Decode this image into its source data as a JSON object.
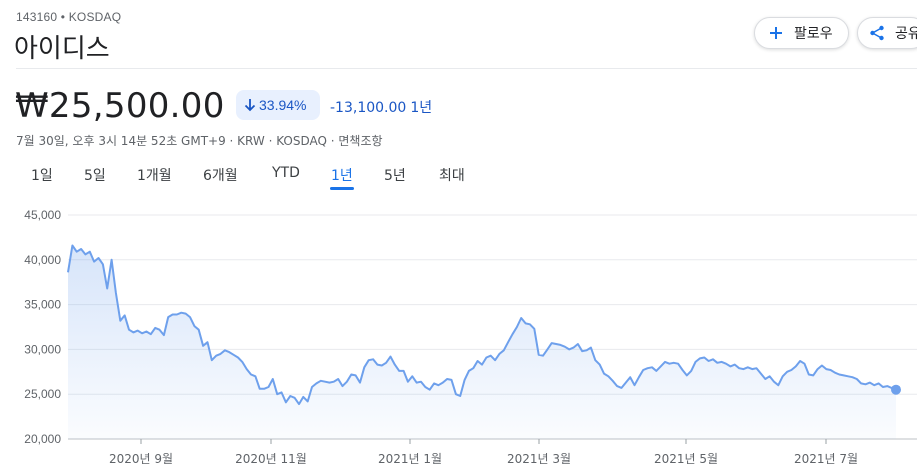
{
  "header": {
    "ticker": "143160 • KOSDAQ",
    "company": "아이디스",
    "follow_label": "팔로우",
    "share_label": "공유"
  },
  "quote": {
    "price": "₩25,500.00",
    "change_pct": "33.94%",
    "change_abs": "-13,100.00",
    "change_period": "1년",
    "meta": "7월 30일, 오후 3시 14분 52초 GMT+9 · KRW · KOSDAQ · 면책조항"
  },
  "range_tabs": [
    {
      "label": "1일"
    },
    {
      "label": "5일"
    },
    {
      "label": "1개월"
    },
    {
      "label": "6개월"
    },
    {
      "label": "YTD"
    },
    {
      "label": "1년",
      "active": true
    },
    {
      "label": "5년"
    },
    {
      "label": "최대"
    }
  ],
  "colors": {
    "line": "#6ea0ec",
    "accent": "#1a73e8",
    "negative": "#1a56c4"
  },
  "icons": {
    "follow": "plus-icon",
    "share": "share-icon",
    "change": "arrow-down-icon"
  },
  "chart_data": {
    "type": "area",
    "title": "",
    "xlabel": "",
    "ylabel": "",
    "ylim": [
      20000,
      45000
    ],
    "yticks": [
      "45,000",
      "40,000",
      "35,000",
      "30,000",
      "25,000",
      "20,000"
    ],
    "xticks": [
      "2020년 9월",
      "2020년 11월",
      "2021년 1월",
      "2021년 3월",
      "2021년 5월",
      "2021년 7월"
    ],
    "grid": true,
    "series": [
      {
        "values": [
          38600,
          41600,
          40900,
          41200,
          40600,
          40900,
          39800,
          40200,
          39500,
          36800,
          40000,
          36300,
          33200,
          33800,
          32200,
          31900,
          32100,
          31800,
          32000,
          31700,
          32400,
          32200,
          31600,
          33600,
          33900,
          33900,
          34100,
          34000,
          33600,
          32600,
          32200,
          30400,
          30800,
          28800,
          29300,
          29500,
          29900,
          29700,
          29400,
          29100,
          28600,
          27800,
          27200,
          27000,
          25600,
          25600,
          25800,
          26700,
          25000,
          25200,
          24100,
          24800,
          24600,
          23900,
          24700,
          24200,
          25800,
          26200,
          26500,
          26400,
          26300,
          26400,
          26700,
          25900,
          26400,
          27200,
          27100,
          26300,
          28000,
          28800,
          28900,
          28300,
          28200,
          28500,
          29200,
          28300,
          27600,
          27600,
          26400,
          27000,
          26300,
          26400,
          25800,
          25500,
          26200,
          26000,
          26300,
          26700,
          26600,
          25000,
          24800,
          26600,
          27600,
          27900,
          28700,
          28300,
          29100,
          29300,
          28800,
          29500,
          29900,
          30800,
          31700,
          32500,
          33500,
          32900,
          32800,
          32300,
          29400,
          29300,
          30000,
          30700,
          30600,
          30500,
          30300,
          30000,
          30200,
          30600,
          29800,
          29900,
          30200,
          28800,
          28300,
          27300,
          27000,
          26500,
          25900,
          25700,
          26300,
          26900,
          26000,
          26900,
          27700,
          27900,
          28000,
          27600,
          28100,
          28600,
          28400,
          28500,
          28400,
          27700,
          27100,
          27600,
          28600,
          29000,
          29100,
          28700,
          28900,
          28500,
          28600,
          28400,
          28100,
          28300,
          27900,
          27800,
          28000,
          27800,
          27900,
          27300,
          26700,
          27000,
          26400,
          26000,
          27000,
          27500,
          27700,
          28100,
          28700,
          28400,
          27200,
          27100,
          27800,
          28200,
          27800,
          27700,
          27400,
          27200,
          27100,
          27000,
          26900,
          26700,
          26200,
          26100,
          26300,
          26000,
          26200,
          25800,
          25900,
          25700,
          25500
        ]
      }
    ]
  }
}
